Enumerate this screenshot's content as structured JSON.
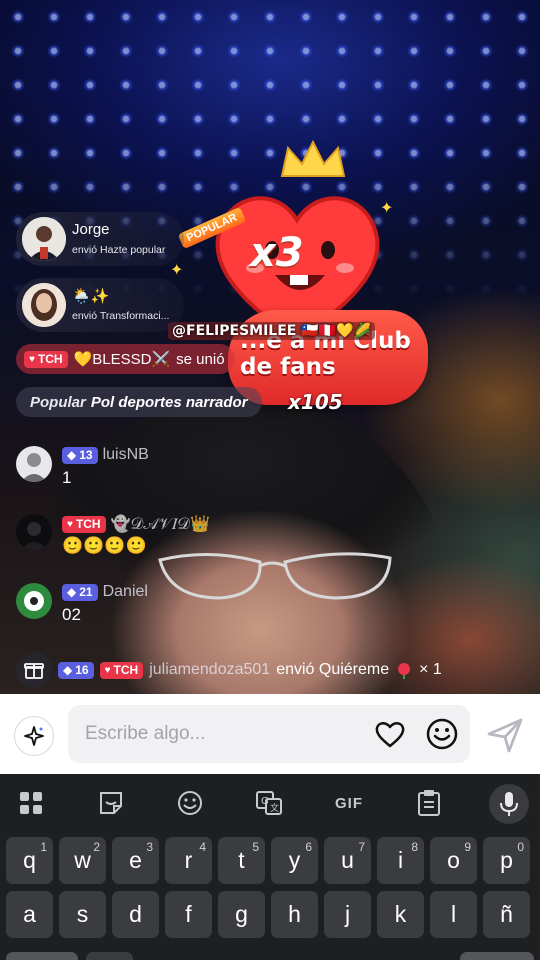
{
  "gift_animation": {
    "popular_tag": "POPULAR",
    "multiplier": "x3",
    "banner_text": "...e a mi Club de fans",
    "sender_handle": "@FELIPESMILEE 🇨🇱🇵🇪💛🌽",
    "count": "x105"
  },
  "gift_notifications": [
    {
      "name": "Jorge",
      "sub": "envió Hazte popular"
    },
    {
      "name": "🌦️✨",
      "sub": "envió Transformaci..."
    }
  ],
  "chat": {
    "join": {
      "badge": "TCH",
      "user": "💛BLESSD⚔️",
      "action": "se unió"
    },
    "popular": {
      "label": "Popular",
      "text": "Pol deportes narrador"
    },
    "messages": [
      {
        "badge_type": "level",
        "badge": "13",
        "user": "luisNB",
        "text": "1"
      },
      {
        "badge_type": "tch",
        "badge": "TCH",
        "user": "👻𝒟𝒜𝒱𝐼𝒟👑",
        "text": "🙂🙂🙂🙂"
      },
      {
        "badge_type": "level",
        "badge": "21",
        "user": "Daniel",
        "text": "02"
      }
    ],
    "gift_message": {
      "level": "16",
      "badge": "TCH",
      "user": "juliamendoza501",
      "action": "envió Quiéreme",
      "count": "× 1"
    }
  },
  "input": {
    "placeholder": "Escribe algo..."
  },
  "keyboard": {
    "gif_label": "GIF",
    "row1": [
      {
        "k": "q",
        "h": "1"
      },
      {
        "k": "w",
        "h": "2"
      },
      {
        "k": "e",
        "h": "3"
      },
      {
        "k": "r",
        "h": "4"
      },
      {
        "k": "t",
        "h": "5"
      },
      {
        "k": "y",
        "h": "6"
      },
      {
        "k": "u",
        "h": "7"
      },
      {
        "k": "i",
        "h": "8"
      },
      {
        "k": "o",
        "h": "9"
      },
      {
        "k": "p",
        "h": "0"
      }
    ],
    "row2": [
      "a",
      "s",
      "d",
      "f",
      "g",
      "h",
      "j",
      "k",
      "l",
      "ñ"
    ]
  }
}
